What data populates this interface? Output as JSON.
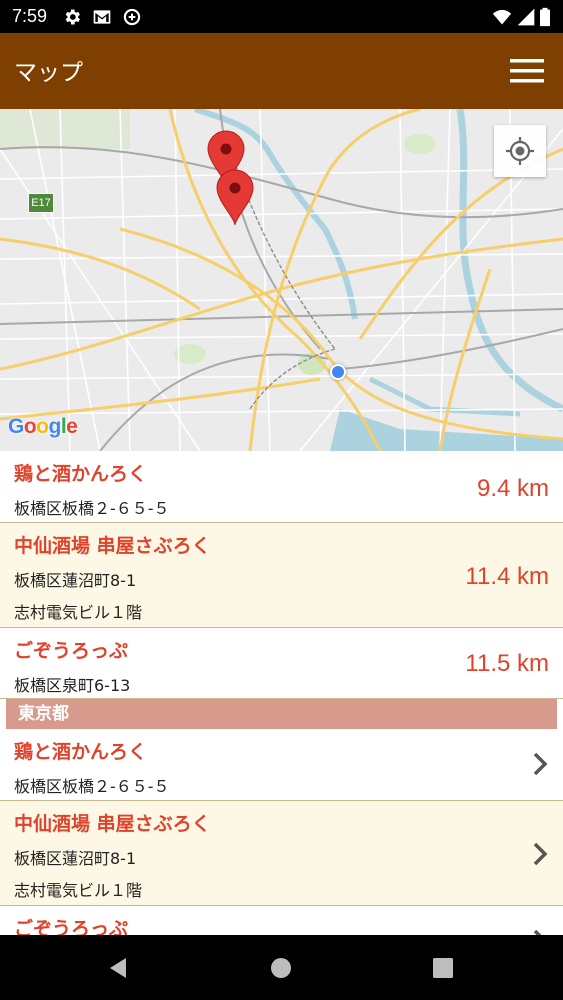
{
  "status_bar": {
    "time": "7:59",
    "left_icons": [
      "settings-icon",
      "gmail-icon",
      "no-data-saver-icon"
    ],
    "right_icons": [
      "wifi-icon",
      "signal-icon",
      "battery-icon"
    ]
  },
  "app_bar": {
    "title": "マップ",
    "menu_icon": "hamburger-menu-icon"
  },
  "map": {
    "attribution": [
      "G",
      "o",
      "o",
      "g",
      "l",
      "e"
    ],
    "highway_label": "E17",
    "locate_icon": "my-location-icon",
    "pins": 2,
    "colors": {
      "water": "#aad3df",
      "park": "#cfe6bf",
      "road_major": "#f6cf6b",
      "road_minor": "#ffffff",
      "rail": "#9e9e9e",
      "pin": "#e53935"
    }
  },
  "nearby": [
    {
      "name": "鶏と酒かんろく",
      "address_lines": [
        "板橋区板橋２-６５-５"
      ],
      "distance": "9.4 km"
    },
    {
      "name": "中仙酒場 串屋さぶろく",
      "address_lines": [
        "板橋区蓮沼町8-1",
        "志村電気ビル１階"
      ],
      "distance": "11.4 km"
    },
    {
      "name": "ごぞうろっぷ",
      "address_lines": [
        "板橋区泉町6-13"
      ],
      "distance": "11.5 km"
    }
  ],
  "section": {
    "header": "東京都",
    "items": [
      {
        "name": "鶏と酒かんろく",
        "address_lines": [
          "板橋区板橋２-６５-５"
        ]
      },
      {
        "name": "中仙酒場 串屋さぶろく",
        "address_lines": [
          "板橋区蓮沼町8-1",
          "志村電気ビル１階"
        ]
      },
      {
        "name": "ごぞうろっぷ",
        "address_lines": []
      }
    ]
  },
  "colors": {
    "app_bar": "#7e3f00",
    "accent_text": "#e0432b",
    "alt_row": "#fdf8e5",
    "section_header": "#d99a8e"
  },
  "nav_bar": {
    "buttons": [
      "back-icon",
      "home-icon",
      "recents-icon"
    ]
  }
}
